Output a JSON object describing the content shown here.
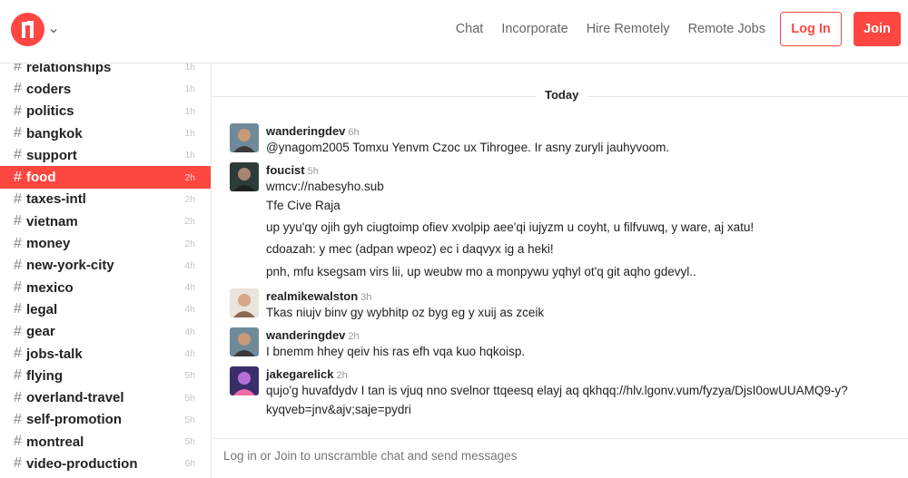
{
  "header": {
    "logo_icon": "nomad-list-logo-icon",
    "dropdown_icon": "chevron-down-icon",
    "nav": [
      "Chat",
      "Incorporate",
      "Hire Remotely",
      "Remote Jobs"
    ],
    "login_label": "Log In",
    "join_label": "Join",
    "accent_color": "#ff4742"
  },
  "sidebar": {
    "channels": [
      {
        "name": "relationships",
        "time": "1h"
      },
      {
        "name": "coders",
        "time": "1h"
      },
      {
        "name": "politics",
        "time": "1h"
      },
      {
        "name": "bangkok",
        "time": "1h"
      },
      {
        "name": "support",
        "time": "1h"
      },
      {
        "name": "food",
        "time": "2h",
        "active": true
      },
      {
        "name": "taxes-intl",
        "time": "2h"
      },
      {
        "name": "vietnam",
        "time": "2h"
      },
      {
        "name": "money",
        "time": "2h"
      },
      {
        "name": "new-york-city",
        "time": "4h"
      },
      {
        "name": "mexico",
        "time": "4h"
      },
      {
        "name": "legal",
        "time": "4h"
      },
      {
        "name": "gear",
        "time": "4h"
      },
      {
        "name": "jobs-talk",
        "time": "4h"
      },
      {
        "name": "flying",
        "time": "5h"
      },
      {
        "name": "overland-travel",
        "time": "5h"
      },
      {
        "name": "self-promotion",
        "time": "5h"
      },
      {
        "name": "montreal",
        "time": "5h"
      },
      {
        "name": "video-production",
        "time": "6h"
      }
    ]
  },
  "chat": {
    "day_label": "Today",
    "groups": [
      {
        "author": "wanderingdev",
        "ago": "6h",
        "avatar": "wanderingdev-avatar",
        "lines": [
          "@ynagom2005 Tomxu Yenvm Czoc ux Tihrogee. Ir asny zuryli jauhyvoom."
        ]
      },
      {
        "author": "foucist",
        "ago": "5h",
        "avatar": "foucist-avatar",
        "lines": [
          "wmcv://nabesyho.sub",
          "Tfe Cive Raja",
          "up yyu'qy ojih gyh ciugtoimp ofiev xvolpip aee'qi iujyzm u coyht, u filfvuwq, y ware, aj xatu!",
          "cdoazah: y mec (adpan wpeoz) ec i daqvyx ig a heki!",
          "pnh, mfu ksegsam virs lii, up weubw mo a monpywu yqhyl ot'q git aqho gdevyl.."
        ]
      },
      {
        "author": "realmikewalston",
        "ago": "3h",
        "avatar": "realmikewalston-avatar",
        "lines": [
          "Tkas niujv binv gy wybhitp oz byg eg y xuij as zceik"
        ]
      },
      {
        "author": "wanderingdev",
        "ago": "2h",
        "avatar": "wanderingdev-avatar",
        "lines": [
          "I bnemm hhey qeiv his ras efh vqa kuo hqkoisp."
        ]
      },
      {
        "author": "jakegarelick",
        "ago": "2h",
        "avatar": "jakegarelick-avatar",
        "lines": [
          "qujo'g huvafdydv I tan is vjuq nno svelnor ttqeesq elayj aq qkhqq://hlv.lgonv.vum/fyzya/DjsI0owUUAMQ9-y?",
          "kyqveb=jnv&ajv;saje=pydri"
        ]
      }
    ],
    "composer_placeholder": "Log in or Join to unscramble chat and send messages"
  }
}
